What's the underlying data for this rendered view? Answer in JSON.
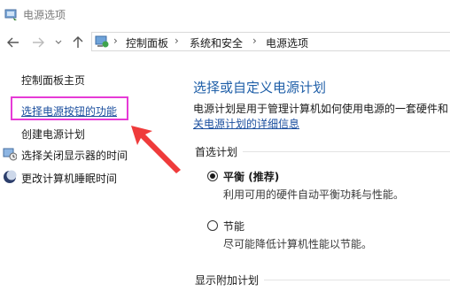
{
  "window": {
    "title": "电源选项"
  },
  "nav": {
    "icons": [
      "back-arrow-icon",
      "forward-arrow-icon",
      "chevron-down-icon",
      "up-arrow-icon"
    ],
    "breadcrumb": [
      "控制面板",
      "系统和安全",
      "电源选项"
    ]
  },
  "sidebar": {
    "home": "控制面板主页",
    "items": [
      {
        "label": "选择电源按钮的功能",
        "icon": ""
      },
      {
        "label": "创建电源计划",
        "icon": ""
      },
      {
        "label": "选择关闭显示器的时间",
        "icon": "monitor-power-icon"
      },
      {
        "label": "更改计算机睡眠时间",
        "icon": "moon-sleep-icon"
      }
    ]
  },
  "main": {
    "title": "选择或自定义电源计划",
    "description": "电源计划是用于管理计算机如何使用电源的一套硬件和",
    "link": "关电源计划的详细信息",
    "preferred_label": "首选计划",
    "plans": [
      {
        "name": "平衡",
        "tag": "(推荐)",
        "desc": "利用可用的硬件自动平衡功耗与性能。",
        "selected": true
      },
      {
        "name": "节能",
        "tag": "",
        "desc": "尽可能降低计算机性能以节能。",
        "selected": false
      }
    ],
    "more_label": "显示附加计划"
  },
  "colors": {
    "accent_title": "#1f5fa8",
    "link": "#1a4e9e",
    "highlight_box": "#e63bd6",
    "annotation_arrow": "#ef3b3b"
  }
}
